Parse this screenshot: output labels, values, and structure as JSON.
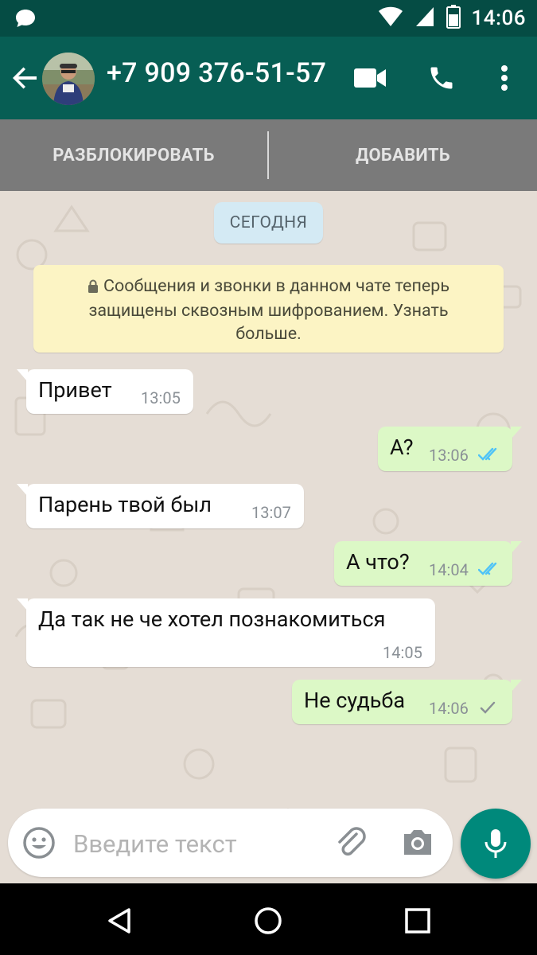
{
  "status_bar": {
    "time": "14:06"
  },
  "header": {
    "contact": "+7 909 376-51-57"
  },
  "actions_bar": {
    "unblock": "РАЗБЛОКИРОВАТЬ",
    "add": "ДОБАВИТЬ"
  },
  "chat": {
    "date_label": "СЕГОДНЯ",
    "encryption_notice": [
      "Сообщения и звонки в данном чате теперь",
      "защищены сквозным шифрованием. Узнать",
      "больше."
    ],
    "messages": [
      {
        "dir": "in",
        "text": "Привет",
        "time": "13:05"
      },
      {
        "dir": "out",
        "text": "А?",
        "time": "13:06",
        "status": "read"
      },
      {
        "dir": "in",
        "text": "Парень твой был",
        "time": "13:07"
      },
      {
        "dir": "out",
        "text": "А что?",
        "time": "14:04",
        "status": "read"
      },
      {
        "dir": "in",
        "text": "Да так не че хотел познакомиться",
        "time": "14:05"
      },
      {
        "dir": "out",
        "text": "Не судьба",
        "time": "14:06",
        "status": "sent"
      }
    ]
  },
  "composer": {
    "placeholder": "Введите текст"
  },
  "colors": {
    "header": "#075e54",
    "status_bar": "#054c44",
    "outgoing": "#dcf8c6",
    "incoming": "#ffffff",
    "read_tick": "#4fc3f7",
    "fab": "#00897b"
  }
}
